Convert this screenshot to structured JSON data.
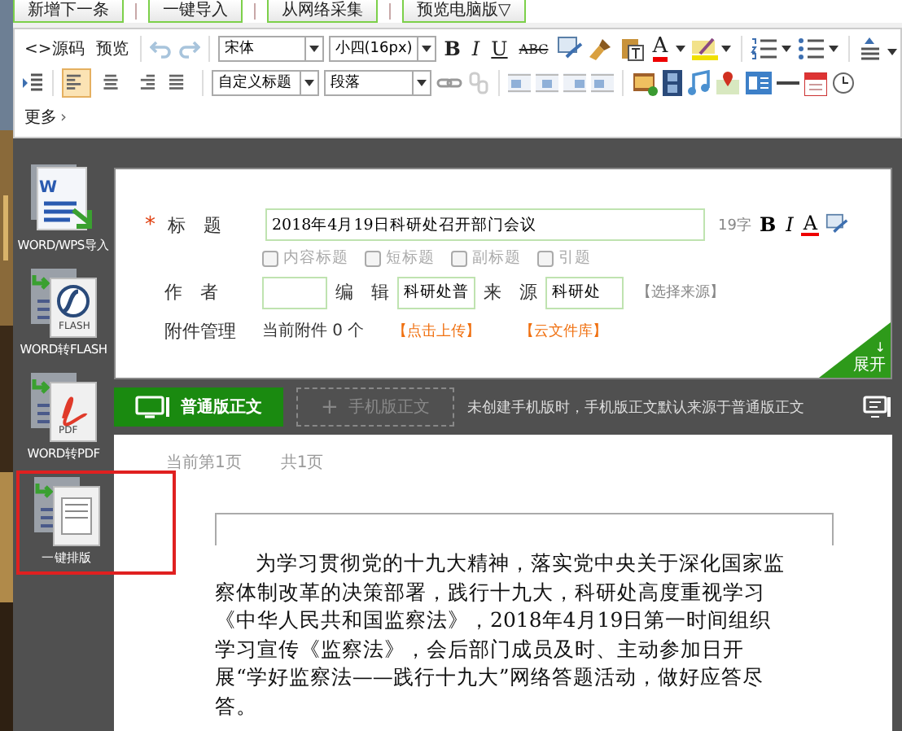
{
  "top_buttons": [
    "新增下一条",
    "一键导入",
    "从网络采集",
    "预览电脑版▽"
  ],
  "toolbar": {
    "source": "<>源码",
    "preview": "预览",
    "font": "宋体",
    "size": "小四(16px)",
    "format_buttons": [
      "B",
      "I",
      "U",
      "ABC"
    ],
    "font_color_letter": "A",
    "align_buttons": [
      {
        "selected": true
      },
      {
        "selected": false
      },
      {
        "selected": false
      },
      {
        "selected": false
      }
    ],
    "heading": "自定义标题",
    "paragraph": "段落",
    "more": "更多",
    "more_arrow": "›"
  },
  "sidebar_tools": [
    {
      "kind": "word",
      "badge": "W",
      "label": "WORD/WPS导入",
      "highlighted": false
    },
    {
      "kind": "flash",
      "badge": "FLASH",
      "label": "WORD转FLASH",
      "highlighted": false
    },
    {
      "kind": "pdf",
      "badge": "PDF",
      "label": "WORD转PDF",
      "highlighted": false
    },
    {
      "kind": "layout",
      "label": "一键排版",
      "highlighted": true
    }
  ],
  "form": {
    "required_mark": "*",
    "title_label": "标　题",
    "title_value": "2018年4月19日科研处召开部门会议",
    "char_count": "19字",
    "title_format": [
      "B",
      "I",
      "A"
    ],
    "checkboxes": [
      {
        "label": "内容标题",
        "checked": false
      },
      {
        "label": "短标题",
        "checked": false
      },
      {
        "label": "副标题",
        "checked": false
      },
      {
        "label": "引题",
        "checked": false
      }
    ],
    "author_label": "作　者",
    "editor_label": "编　辑",
    "editor_value": "科研处普",
    "source_label": "来　源",
    "source_value": "科研处",
    "source_link": "【选择来源】",
    "attachments_label": "附件管理",
    "attachments_text": "当前附件 0 个",
    "upload_link": "【点击上传】",
    "cloud_link": "【云文件库】",
    "expand_arrow": "↓",
    "expand": "展开"
  },
  "body_tabs": [
    {
      "label": "普通版正文",
      "selected": true
    },
    {
      "icon": "+",
      "label": "手机版正文",
      "selected": false
    }
  ],
  "body_note": "未创建手机版时，手机版正文默认来源于普通版正文",
  "editor": {
    "current_page": "当前第1页",
    "total_pages": "共1页",
    "paragraph": "为学习贯彻党的十九大精神，落实党中央关于深化国家监察体制改革的决策部署，践行十九大，科研处高度重视学习《中华人民共和国监察法》，2018年4月19日第一时间组织学习宣传《监察法》，会后部门成员及时、主动参加日开展“学好监察法——践行十九大”网络答题活动，做好应答尽答。"
  }
}
